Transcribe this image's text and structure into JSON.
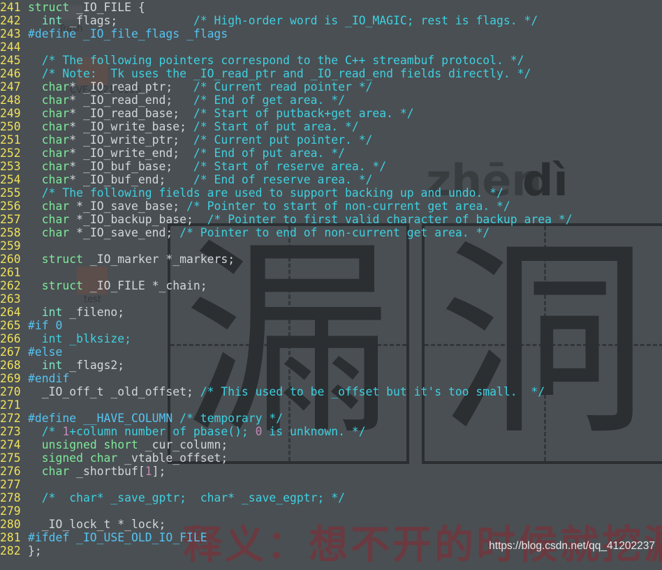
{
  "editor": {
    "lines": [
      {
        "n": "241",
        "parts": [
          {
            "t": "struct",
            "c": "kw"
          },
          {
            "t": " _IO_FILE {",
            "c": "code"
          }
        ]
      },
      {
        "n": "242",
        "parts": [
          {
            "t": "  ",
            "c": "code"
          },
          {
            "t": "int",
            "c": "ty"
          },
          {
            "t": " _flags;           ",
            "c": "code"
          },
          {
            "t": "/* High-order word is _IO_MAGIC; rest is flags. */",
            "c": "cm"
          }
        ]
      },
      {
        "n": "243",
        "parts": [
          {
            "t": "#define _IO_file_flags _flags",
            "c": "pp"
          }
        ]
      },
      {
        "n": "244",
        "parts": []
      },
      {
        "n": "245",
        "parts": [
          {
            "t": "  ",
            "c": "code"
          },
          {
            "t": "/* The following pointers correspond to the C++ streambuf protocol. */",
            "c": "cm"
          }
        ]
      },
      {
        "n": "246",
        "parts": [
          {
            "t": "  ",
            "c": "code"
          },
          {
            "t": "/* Note:  Tk uses the _IO_read_ptr and _IO_read_end fields directly. */",
            "c": "cm"
          }
        ]
      },
      {
        "n": "247",
        "parts": [
          {
            "t": "  ",
            "c": "code"
          },
          {
            "t": "char",
            "c": "kw"
          },
          {
            "t": "* _IO_read_ptr;   ",
            "c": "code"
          },
          {
            "t": "/* Current read pointer */",
            "c": "cm"
          }
        ]
      },
      {
        "n": "248",
        "parts": [
          {
            "t": "  ",
            "c": "code"
          },
          {
            "t": "char",
            "c": "kw"
          },
          {
            "t": "* _IO_read_end;   ",
            "c": "code"
          },
          {
            "t": "/* End of get area. */",
            "c": "cm"
          }
        ]
      },
      {
        "n": "249",
        "parts": [
          {
            "t": "  ",
            "c": "code"
          },
          {
            "t": "char",
            "c": "kw"
          },
          {
            "t": "* _IO_read_base;  ",
            "c": "code"
          },
          {
            "t": "/* Start of putback+get area. */",
            "c": "cm"
          }
        ]
      },
      {
        "n": "250",
        "parts": [
          {
            "t": "  ",
            "c": "code"
          },
          {
            "t": "char",
            "c": "kw"
          },
          {
            "t": "* _IO_write_base; ",
            "c": "code"
          },
          {
            "t": "/* Start of put area. */",
            "c": "cm"
          }
        ]
      },
      {
        "n": "251",
        "parts": [
          {
            "t": "  ",
            "c": "code"
          },
          {
            "t": "char",
            "c": "kw"
          },
          {
            "t": "* _IO_write_ptr;  ",
            "c": "code"
          },
          {
            "t": "/* Current put pointer. */",
            "c": "cm"
          }
        ]
      },
      {
        "n": "252",
        "parts": [
          {
            "t": "  ",
            "c": "code"
          },
          {
            "t": "char",
            "c": "kw"
          },
          {
            "t": "* _IO_write_end;  ",
            "c": "code"
          },
          {
            "t": "/* End of put area. */",
            "c": "cm"
          }
        ]
      },
      {
        "n": "253",
        "parts": [
          {
            "t": "  ",
            "c": "code"
          },
          {
            "t": "char",
            "c": "kw"
          },
          {
            "t": "* _IO_buf_base;   ",
            "c": "code"
          },
          {
            "t": "/* Start of reserve area. */",
            "c": "cm"
          }
        ]
      },
      {
        "n": "254",
        "parts": [
          {
            "t": "  ",
            "c": "code"
          },
          {
            "t": "char",
            "c": "kw"
          },
          {
            "t": "* _IO_buf_end;    ",
            "c": "code"
          },
          {
            "t": "/* End of reserve area. */",
            "c": "cm"
          }
        ]
      },
      {
        "n": "255",
        "parts": [
          {
            "t": "  ",
            "c": "code"
          },
          {
            "t": "/* The following fields are used to support backing up and undo. */",
            "c": "cm"
          }
        ]
      },
      {
        "n": "256",
        "parts": [
          {
            "t": "  ",
            "c": "code"
          },
          {
            "t": "char",
            "c": "kw"
          },
          {
            "t": " *_IO_save_base; ",
            "c": "code"
          },
          {
            "t": "/* Pointer to start of non-current get area. */",
            "c": "cm"
          }
        ]
      },
      {
        "n": "257",
        "parts": [
          {
            "t": "  ",
            "c": "code"
          },
          {
            "t": "char",
            "c": "kw"
          },
          {
            "t": " *_IO_backup_base;  ",
            "c": "code"
          },
          {
            "t": "/* Pointer to first valid character of backup area */",
            "c": "cm"
          }
        ]
      },
      {
        "n": "258",
        "parts": [
          {
            "t": "  ",
            "c": "code"
          },
          {
            "t": "char",
            "c": "kw"
          },
          {
            "t": " *_IO_save_end; ",
            "c": "code"
          },
          {
            "t": "/* Pointer to end of non-current get area. */",
            "c": "cm"
          }
        ]
      },
      {
        "n": "259",
        "parts": []
      },
      {
        "n": "260",
        "parts": [
          {
            "t": "  ",
            "c": "code"
          },
          {
            "t": "struct",
            "c": "kw"
          },
          {
            "t": " _IO_marker *_markers;",
            "c": "code"
          }
        ]
      },
      {
        "n": "261",
        "parts": []
      },
      {
        "n": "262",
        "parts": [
          {
            "t": "  ",
            "c": "code"
          },
          {
            "t": "struct",
            "c": "kw"
          },
          {
            "t": " _IO_FILE *_chain;",
            "c": "code"
          }
        ]
      },
      {
        "n": "263",
        "parts": []
      },
      {
        "n": "264",
        "parts": [
          {
            "t": "  ",
            "c": "code"
          },
          {
            "t": "int",
            "c": "ty"
          },
          {
            "t": " _fileno;",
            "c": "code"
          }
        ]
      },
      {
        "n": "265",
        "parts": [
          {
            "t": "#if 0",
            "c": "pp"
          }
        ]
      },
      {
        "n": "266",
        "parts": [
          {
            "t": "  int _blksize;",
            "c": "cm"
          }
        ]
      },
      {
        "n": "267",
        "parts": [
          {
            "t": "#else",
            "c": "pp"
          }
        ]
      },
      {
        "n": "268",
        "parts": [
          {
            "t": "  ",
            "c": "code"
          },
          {
            "t": "int",
            "c": "ty"
          },
          {
            "t": " _flags2;",
            "c": "code"
          }
        ]
      },
      {
        "n": "269",
        "parts": [
          {
            "t": "#endif",
            "c": "pp"
          }
        ]
      },
      {
        "n": "270",
        "parts": [
          {
            "t": "  _IO_off_t _old_offset; ",
            "c": "code"
          },
          {
            "t": "/* This used to be _offset but it's too small.  */",
            "c": "cm"
          }
        ]
      },
      {
        "n": "271",
        "parts": []
      },
      {
        "n": "272",
        "parts": [
          {
            "t": "#define __HAVE_COLUMN ",
            "c": "pp"
          },
          {
            "t": "/* temporary */",
            "c": "cm"
          }
        ]
      },
      {
        "n": "273",
        "parts": [
          {
            "t": "  ",
            "c": "code"
          },
          {
            "t": "/* ",
            "c": "cm"
          },
          {
            "t": "1",
            "c": "num"
          },
          {
            "t": "+column number of pbase(); ",
            "c": "cm"
          },
          {
            "t": "0",
            "c": "num"
          },
          {
            "t": " is unknown. */",
            "c": "cm"
          }
        ]
      },
      {
        "n": "274",
        "parts": [
          {
            "t": "  ",
            "c": "code"
          },
          {
            "t": "unsigned short",
            "c": "kw"
          },
          {
            "t": " _cur_column;",
            "c": "code"
          }
        ]
      },
      {
        "n": "275",
        "parts": [
          {
            "t": "  ",
            "c": "code"
          },
          {
            "t": "signed char",
            "c": "kw"
          },
          {
            "t": " _vtable_offset;",
            "c": "code"
          }
        ]
      },
      {
        "n": "276",
        "parts": [
          {
            "t": "  ",
            "c": "code"
          },
          {
            "t": "char",
            "c": "kw"
          },
          {
            "t": " _shortbuf[",
            "c": "code"
          },
          {
            "t": "1",
            "c": "num"
          },
          {
            "t": "];",
            "c": "code"
          }
        ]
      },
      {
        "n": "277",
        "parts": []
      },
      {
        "n": "278",
        "parts": [
          {
            "t": "  ",
            "c": "code"
          },
          {
            "t": "/*  char* _save_gptr;  char* _save_egptr; */",
            "c": "cm"
          }
        ]
      },
      {
        "n": "279",
        "parts": []
      },
      {
        "n": "280",
        "parts": [
          {
            "t": "  _IO_lock_t *_lock;",
            "c": "code"
          }
        ]
      },
      {
        "n": "281",
        "parts": [
          {
            "t": "#ifdef _IO_USE_OLD_IO_FILE",
            "c": "pp"
          }
        ]
      },
      {
        "n": "282",
        "parts": [
          {
            "t": "};",
            "c": "code"
          }
        ]
      }
    ]
  },
  "wallpaper": {
    "pinyin_1": "zhēn",
    "pinyin_2": "dì",
    "char_1": "漏",
    "char_2": "洞",
    "caption": "释义：想不开的时候就挖漏洞",
    "desktop_icons": [
      {
        "label": "Trash"
      },
      {
        "label": "CVE-2021-3156"
      },
      {
        "label": "test"
      }
    ]
  },
  "watermark": "https://blog.csdn.net/qq_41202237"
}
